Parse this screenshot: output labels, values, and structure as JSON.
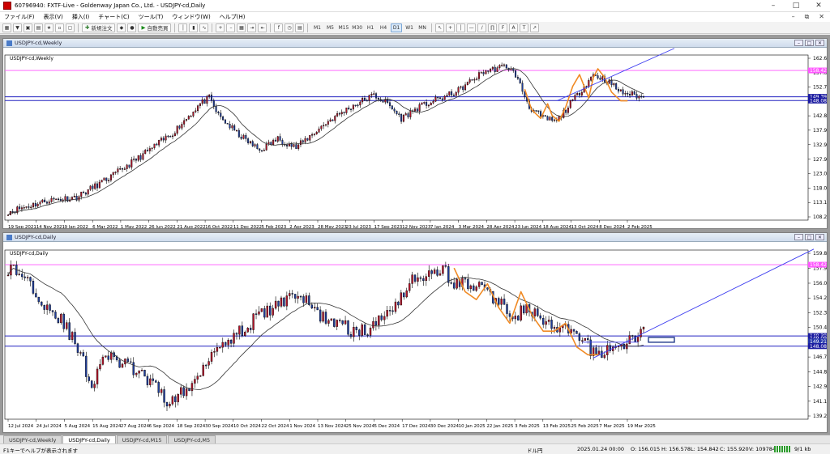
{
  "window": {
    "title": "60796940: FXTF-Live - Goldenway Japan Co., Ltd. - USDJPY-cd,Daily"
  },
  "menu": [
    "ファイル(F)",
    "表示(V)",
    "挿入(I)",
    "チャート(C)",
    "ツール(T)",
    "ウィンドウ(W)",
    "ヘルプ(H)"
  ],
  "toolbar": {
    "new_order_label": "新規注文",
    "auto_trade_label": "自動売買",
    "timeframes": [
      "M1",
      "M5",
      "M15",
      "M30",
      "H1",
      "H4",
      "D1",
      "W1",
      "MN"
    ],
    "active_timeframe": "D1"
  },
  "weekly": {
    "window_title": "USDJPY-cd,Weekly",
    "chart_label": "USDJPY-cd,Weekly",
    "price_labels": [
      "162.600",
      "157.670",
      "152.740",
      "147.805",
      "142.875",
      "137.945",
      "132.975",
      "127.975",
      "123.015",
      "118.085",
      "113.155",
      "108.225"
    ],
    "magenta_price": "158.425",
    "blue_price1": "149.392",
    "blue_price2": "148.089",
    "date_labels": [
      "19 Sep 2021",
      "14 Nov 2021",
      "9 Jan 2022",
      "6 Mar 2022",
      "1 May 2022",
      "26 Jun 2022",
      "21 Aug 2022",
      "16 Oct 2022",
      "11 Dec 2022",
      "5 Feb 2023",
      "2 Apr 2023",
      "28 May 2023",
      "23 Jul 2023",
      "17 Sep 2023",
      "12 Nov 2023",
      "7 Jan 2024",
      "3 Mar 2024",
      "28 Apr 2024",
      "23 Jun 2024",
      "18 Aug 2024",
      "13 Oct 2024",
      "8 Dec 2024",
      "2 Feb 2025"
    ]
  },
  "daily": {
    "window_title": "USDJPY-cd,Daily",
    "chart_label": "USDJPY-cd,Daily",
    "price_labels": [
      "159.870",
      "157.965",
      "156.075",
      "154.205",
      "152.335",
      "150.465",
      "148.595",
      "146.725",
      "144.855",
      "142.985",
      "141.115",
      "139.245"
    ],
    "magenta_price": "158.425",
    "blue_price1": "149.392",
    "blue_price2": "149.099",
    "box_price": "149.210",
    "blue_price3": "148.089",
    "date_labels": [
      "12 Jul 2024",
      "24 Jul 2024",
      "5 Aug 2024",
      "15 Aug 2024",
      "27 Aug 2024",
      "6 Sep 2024",
      "18 Sep 2024",
      "30 Sep 2024",
      "10 Oct 2024",
      "22 Oct 2024",
      "1 Nov 2024",
      "13 Nov 2024",
      "25 Nov 2024",
      "5 Dec 2024",
      "17 Dec 2024",
      "30 Dec 2024",
      "10 Jan 2025",
      "22 Jan 2025",
      "3 Feb 2025",
      "13 Feb 2025",
      "25 Feb 2025",
      "7 Mar 2025",
      "19 Mar 2025"
    ]
  },
  "tabs": [
    "USDJPY-cd,Weekly",
    "USDJPY-cd,Daily",
    "USDJPY-cd,M15",
    "USDJPY-cd,M5"
  ],
  "active_tab": "USDJPY-cd,Daily",
  "status": {
    "help": "F1キーでヘルプが表示されます",
    "profile": "ドル円",
    "datetime": "2025.01.24 00:00",
    "open": "O: 156.015",
    "high": "H: 156.578",
    "low": "L: 154.842",
    "close": "C: 155.920",
    "volume": "V: 109784",
    "traffic": "9/1 kb"
  },
  "colors": {
    "bull": "#b5152b",
    "bear": "#1f3d9c",
    "ma": "#333333",
    "orange": "#f08a24",
    "trend": "#3d3df0",
    "magenta": "#ff55ff"
  }
}
